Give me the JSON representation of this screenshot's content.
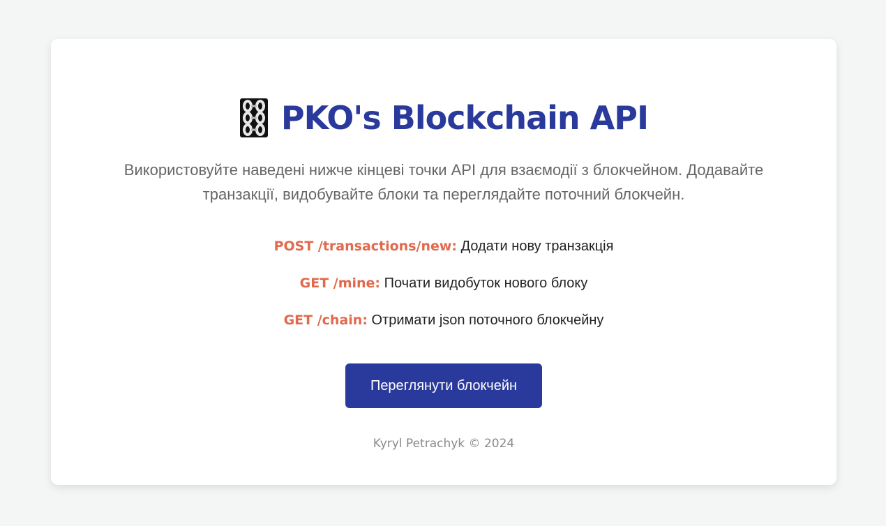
{
  "header": {
    "icon": "chain-icon",
    "title": "PKO's Blockchain API"
  },
  "description": "Використовуйте наведені нижче кінцеві точки API для взаємодії з блокчейном. Додавайте транзакції, видобувайте блоки та переглядайте поточний блокчейн.",
  "endpoints": [
    {
      "method_path": "POST /transactions/new:",
      "text": "Додати нову транзакція"
    },
    {
      "method_path": "GET /mine:",
      "text": "Почати видобуток нового блоку"
    },
    {
      "method_path": "GET /chain:",
      "text": "Отримати json поточного блокчейну"
    }
  ],
  "button": {
    "label": "Переглянути блокчейн"
  },
  "footer": "Kyryl Petrachyk © 2024",
  "colors": {
    "background": "#f4f6f5",
    "accent": "#2a3a9c",
    "endpoint_method": "#e06a4d"
  }
}
